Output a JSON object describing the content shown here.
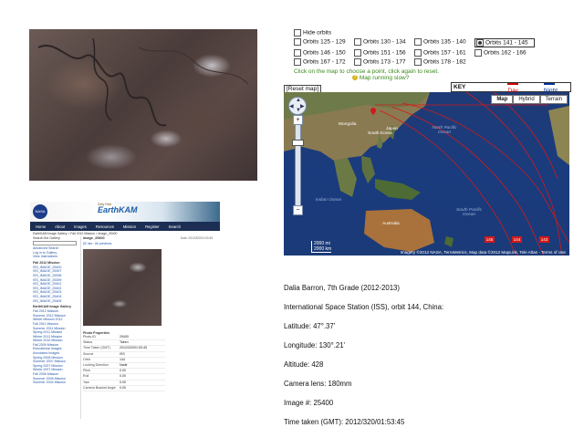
{
  "orbits": {
    "hide_label": "Hide orbits",
    "items": [
      {
        "label": "Orbits 125 - 129",
        "checked": false
      },
      {
        "label": "Orbits 130 - 134",
        "checked": false
      },
      {
        "label": "Orbits 135 - 140",
        "checked": false
      },
      {
        "label": "Orbits 141 - 145",
        "checked": true
      },
      {
        "label": "Orbits 146 - 150",
        "checked": false
      },
      {
        "label": "Orbits 151 - 156",
        "checked": false
      },
      {
        "label": "Orbits 157 - 161",
        "checked": false
      },
      {
        "label": "Orbits 162 - 166",
        "checked": false
      },
      {
        "label": "Orbits 167 - 172",
        "checked": false
      },
      {
        "label": "Orbits 173 - 177",
        "checked": false
      },
      {
        "label": "Orbits 178 - 182",
        "checked": false
      }
    ],
    "instructions": "Click on the map to choose a point, click again to reset.",
    "slow_link": "Map running slow?"
  },
  "map": {
    "reset_label": "[Reset map]",
    "key_label": "KEY",
    "day_label": "Day",
    "night_label": "Night",
    "day_color": "#cc0000",
    "night_color": "#003399",
    "types": [
      "Map",
      "Hybrid",
      "Terrain"
    ],
    "labels": {
      "mongolia": "Mongolia",
      "south_korea": "South Korea",
      "japan": "Japan",
      "north_pacific": "North Pacific Ocean",
      "south_pacific": "South Pacific Ocean",
      "indian": "Indian Ocean",
      "australia": "Australia"
    },
    "orbit_tags": [
      "145",
      "144",
      "143"
    ],
    "scale": "2000 mi\n2000 km",
    "credit": "Imagery ©2012 NASA, TerraMetrics, Map data ©2012 MapLink, Tele Atlas - Terms of Use"
  },
  "site": {
    "logo": "NASA",
    "brand_small": "Sally Ride",
    "brand": "EarthKAM",
    "nav": [
      "Home",
      "About",
      "Images",
      "Resources",
      "Mission",
      "Register",
      "Search"
    ],
    "crumb": "EarthKAM Image Gallery > Fall 2012 Mission > Image_25400",
    "sidebar": {
      "search_label": "Search the Gallery",
      "advanced": "Advanced Search",
      "links_top": [
        "Log in to Gallery",
        "View Instructions"
      ],
      "mission_header": "Fall 2012 Mission",
      "image_links": [
        "ISS_IMAGE_25400",
        "ISS_IMAGE_25397",
        "ISS_IMAGE_25398",
        "ISS_IMAGE_25399",
        "ISS_IMAGE_25401",
        "ISS_IMAGE_25402",
        "ISS_IMAGE_25403",
        "ISS_IMAGE_25404",
        "ISS_IMAGE_25405"
      ],
      "gallery_header": "EarthKAM Image Gallery",
      "missions": [
        "Fall 2012 Mission",
        "Summer 2012 Mission",
        "Winter Mission 2012",
        "Fall 2011 Mission",
        "Summer 2011 Mission",
        "Spring 2011 Mission",
        "Winter 2011 Mission",
        "Winter 2010 Mission",
        "Fall 2009 Mission",
        "Educational Images",
        "Annotated Images",
        "Spring 2008 Mission",
        "Summer 2007 Mission",
        "Spring 2007 Mission",
        "Winter 2007 Mission",
        "Fall 2006 Mission",
        "Summer 2006 Mission",
        "Summer 2004 Mission"
      ]
    },
    "title": "image_25400",
    "date": "Date: 2012/320/01:53:45",
    "zoom": "82 mm  :  84 previews",
    "props_header": "Photo Properties",
    "props": [
      {
        "k": "Photo ID",
        "v": "25400"
      },
      {
        "k": "Status",
        "v": "Taken"
      },
      {
        "k": "Time Taken (GMT)",
        "v": "2012/320/01:53:45"
      },
      {
        "k": "Source",
        "v": "ISS"
      },
      {
        "k": "Orbit",
        "v": "144"
      },
      {
        "k": "Looking Direction",
        "v": "Nadir"
      },
      {
        "k": "Pitch",
        "v": "0.00"
      },
      {
        "k": "Roll",
        "v": "0.00"
      },
      {
        "k": "Yaw",
        "v": "0.00"
      },
      {
        "k": "Camera Bracket Angle",
        "v": "0.00"
      }
    ]
  },
  "details": [
    "Dalia Barron, 7th Grade (2012-2013)",
    "International Space Station (ISS), orbit 144, China:",
    "Latitude:  47°.37'",
    "Longitude:  130°.21'",
    "Altitude:  428",
    "Camera lens:  180mm",
    "Image #:  25400",
    "Time taken (GMT):  2012/320/01:53:45"
  ]
}
